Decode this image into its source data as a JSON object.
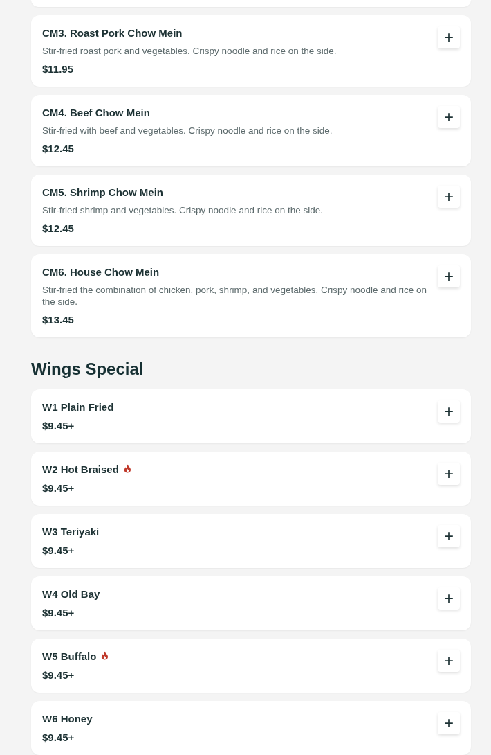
{
  "sections": [
    {
      "items": [
        {
          "name": "CM3. Roast Pork Chow Mein",
          "description": "Stir-fried roast pork and vegetables. Crispy noodle and rice on the side.",
          "price": "$11.95",
          "spicy": false,
          "button": "+"
        },
        {
          "name": "CM4. Beef Chow Mein",
          "description": "Stir-fried with beef and vegetables. Crispy noodle and rice on the side.",
          "price": "$12.45",
          "spicy": false,
          "button": "+"
        },
        {
          "name": "CM5. Shrimp Chow Mein",
          "description": "Stir-fried shrimp and vegetables. Crispy noodle and rice on the side.",
          "price": "$12.45",
          "spicy": false,
          "button": "+"
        },
        {
          "name": "CM6. House Chow Mein",
          "description": "Stir-fried the combination of chicken, pork, shrimp, and vegetables. Crispy noodle and rice on the side.",
          "price": "$13.45",
          "spicy": false,
          "button": "+"
        }
      ]
    },
    {
      "title": "Wings Special",
      "items": [
        {
          "name": "W1 Plain Fried",
          "price": "$9.45+",
          "spicy": false,
          "button": "+"
        },
        {
          "name": "W2 Hot Braised",
          "price": "$9.45+",
          "spicy": true,
          "button": "+"
        },
        {
          "name": "W3 Teriyaki",
          "price": "$9.45+",
          "spicy": false,
          "button": "+"
        },
        {
          "name": "W4 Old Bay",
          "price": "$9.45+",
          "spicy": false,
          "button": "+"
        },
        {
          "name": "W5 Buffalo",
          "price": "$9.45+",
          "spicy": true,
          "button": "+"
        },
        {
          "name": "W6 Honey",
          "price": "$9.45+",
          "spicy": false,
          "button": "+"
        }
      ]
    }
  ]
}
